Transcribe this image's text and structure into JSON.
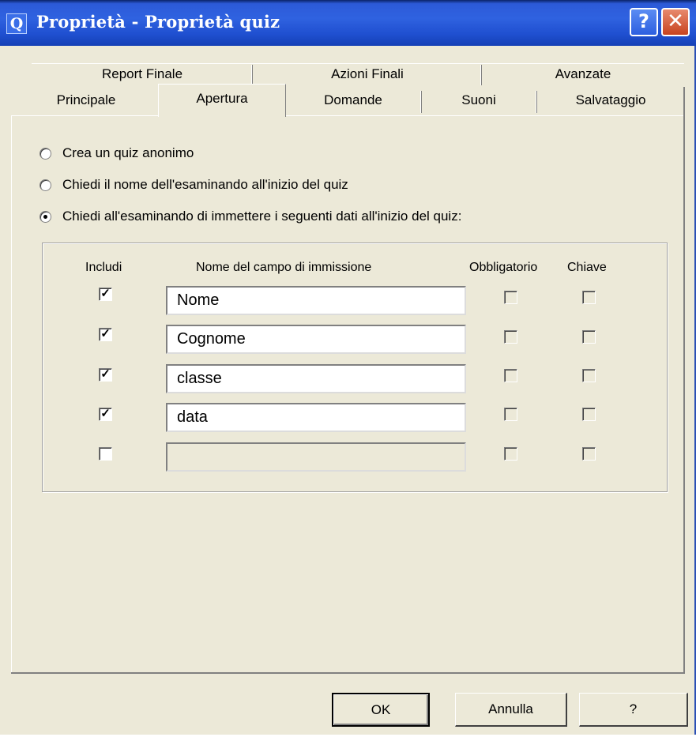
{
  "window": {
    "app_icon_letter": "Q",
    "title": "Proprietà - Proprietà quiz",
    "help_symbol": "?",
    "close_symbol": "✕"
  },
  "tabs": {
    "row_back": [
      "Report Finale",
      "Azioni Finali",
      "Avanzate"
    ],
    "row_front": [
      "Principale",
      "Apertura",
      "Domande",
      "Suoni",
      "Salvataggio"
    ],
    "active": "Apertura"
  },
  "options": [
    {
      "label": "Crea un quiz anonimo",
      "selected": false
    },
    {
      "label": "Chiedi il nome dell'esaminando all'inizio del quiz",
      "selected": false
    },
    {
      "label": "Chiedi all'esaminando di immettere i seguenti dati all'inizio del quiz:",
      "selected": true
    }
  ],
  "fields_table": {
    "headers": {
      "include": "Includi",
      "name": "Nome del campo di immissione",
      "required": "Obbligatorio",
      "key": "Chiave"
    },
    "rows": [
      {
        "include": true,
        "value": "Nome",
        "required": false,
        "key": false
      },
      {
        "include": true,
        "value": "Cognome",
        "required": false,
        "key": false
      },
      {
        "include": true,
        "value": "classe",
        "required": false,
        "key": false
      },
      {
        "include": true,
        "value": "data",
        "required": false,
        "key": false
      },
      {
        "include": false,
        "value": "",
        "required": false,
        "key": false
      }
    ]
  },
  "buttons": {
    "ok": "OK",
    "cancel": "Annulla",
    "help": "?"
  },
  "colors": {
    "dialog_bg": "#ECE9D8",
    "titlebar": "#2f62e0"
  }
}
